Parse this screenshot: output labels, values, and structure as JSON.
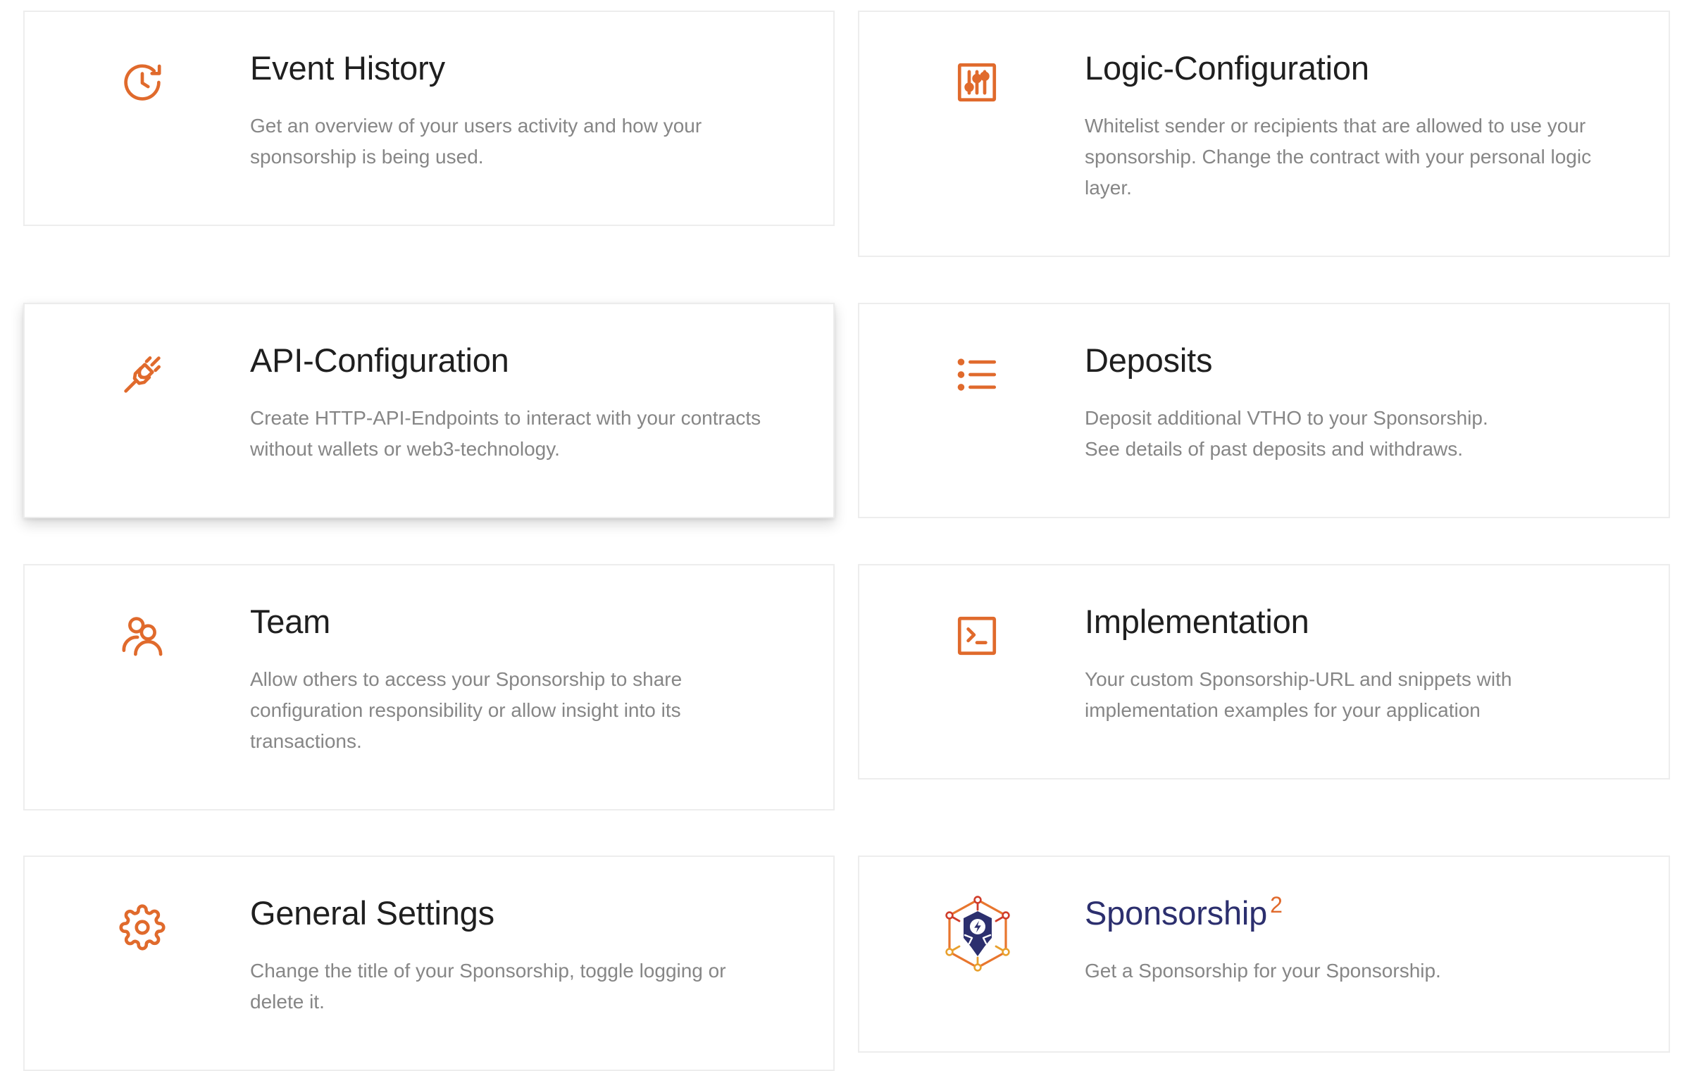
{
  "accent_color": "#e06a2c",
  "brand_color": "#2c2f6e",
  "cards": [
    {
      "title": "Event History",
      "icon": "clock-history-icon",
      "description": "Get an overview of your users activity and how your sponsorship is being used."
    },
    {
      "title": "Logic-Configuration",
      "icon": "sliders-icon",
      "description": "Whitelist sender or recipients that are allowed to use your sponsorship. Change the contract with your personal logic layer."
    },
    {
      "title": "API-Configuration",
      "icon": "plug-icon",
      "description": "Create HTTP-API-Endpoints to interact with your contracts without wallets or web3-technology."
    },
    {
      "title": "Deposits",
      "icon": "list-icon",
      "description_line1": "Deposit additional VTHO to your Sponsorship.",
      "description_line2": "See details of past deposits and withdraws."
    },
    {
      "title": "Team",
      "icon": "users-icon",
      "description": "Allow others to access your Sponsorship to share configuration responsibility or allow insight into its transactions."
    },
    {
      "title": "Implementation",
      "icon": "terminal-icon",
      "description": "Your custom Sponsorship-URL and snippets with implementation examples for your application"
    },
    {
      "title": "General Settings",
      "icon": "gear-icon",
      "description": "Change the title of your Sponsorship, toggle logging or delete it."
    },
    {
      "title": "Sponsorship",
      "title_superscript": "2",
      "icon": "sponsorship-logo-icon",
      "description": "Get a Sponsorship for your Sponsorship."
    }
  ]
}
